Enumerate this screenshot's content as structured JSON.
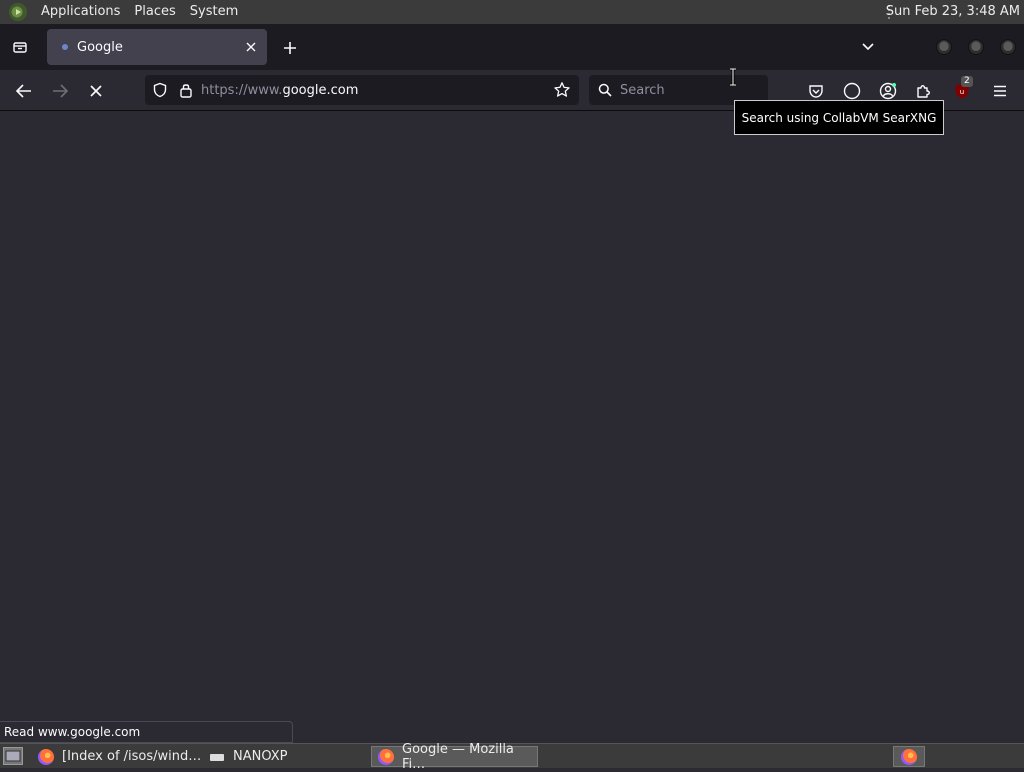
{
  "top_panel": {
    "menus": [
      "Applications",
      "Places",
      "System"
    ],
    "clock": "Sun Feb 23,  3:48 AM"
  },
  "browser": {
    "tab": {
      "title": "Google"
    },
    "url": {
      "scheme": "https://www.",
      "domain": "google.com"
    },
    "search": {
      "placeholder": "Search"
    },
    "tooltip": "Search using CollabVM SearXNG",
    "extension_badge": "2",
    "status_text": "Read www.google.com"
  },
  "taskbar": {
    "items": [
      "[Index of /isos/wind…",
      "NANOXP",
      "Google — Mozilla Fi…"
    ]
  },
  "colors": {
    "accent": "#7aa7ff",
    "toolbar_bg": "#2b2a33",
    "tabstrip_bg": "#1c1b22"
  }
}
